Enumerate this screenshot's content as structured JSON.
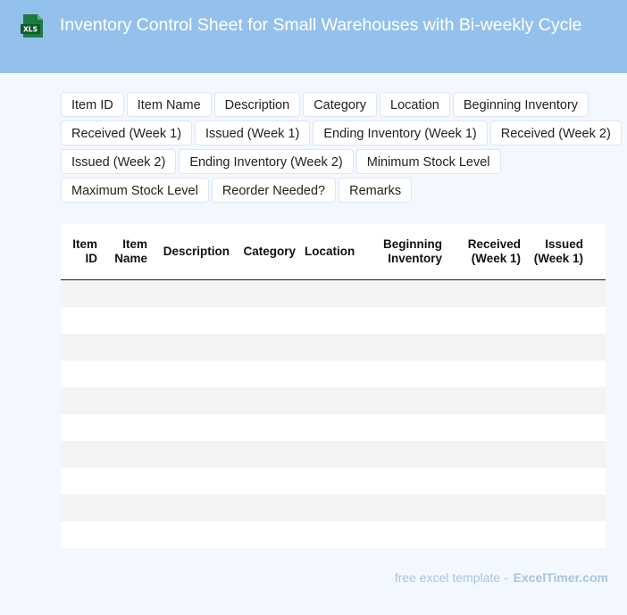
{
  "header": {
    "title": "Inventory Control Sheet for Small Warehouses with Bi-weekly Cycle",
    "icon_label": "XLS",
    "icon": "excel-file-icon"
  },
  "fields": [
    "Item ID",
    "Item Name",
    "Description",
    "Category",
    "Location",
    "Beginning Inventory",
    "Received (Week 1)",
    "Issued (Week 1)",
    "Ending Inventory (Week 1)",
    "Received (Week 2)",
    "Issued (Week 2)",
    "Ending Inventory (Week 2)",
    "Minimum Stock Level",
    "Maximum Stock Level",
    "Reorder Needed?",
    "Remarks"
  ],
  "table": {
    "headers": [
      "Item ID",
      "Item Name",
      "Description",
      "Category",
      "Location",
      "Beginning Inventory",
      "Received (Week 1)",
      "Issued (Week 1)",
      "Ending Inventory (Week 1)"
    ],
    "row_count": 10
  },
  "footer": {
    "text": "free excel template -",
    "brand": "ExcelTimer.com"
  },
  "colors": {
    "header_bg": "#94c1eb",
    "page_bg": "#f2f8fe",
    "icon_green": "#1e7a45",
    "footer_text": "#a9c4dd"
  }
}
